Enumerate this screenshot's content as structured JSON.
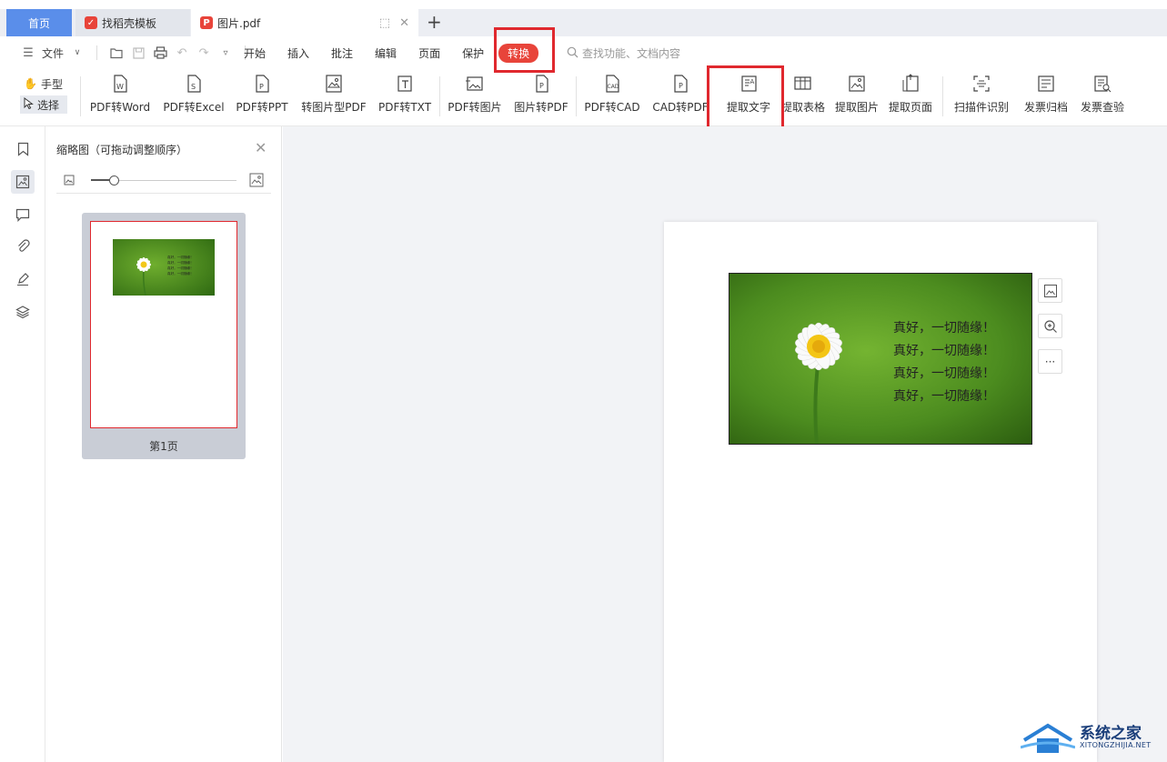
{
  "tabs": {
    "home": "首页",
    "template": "找稻壳模板",
    "pdf": "图片.pdf"
  },
  "menu": {
    "file": "文件",
    "items": [
      "开始",
      "插入",
      "批注",
      "编辑",
      "页面",
      "保护"
    ],
    "active": "转换",
    "search_placeholder": "查找功能、文档内容"
  },
  "ribbon": {
    "hand": "手型",
    "select": "选择",
    "buttons": [
      "PDF转Word",
      "PDF转Excel",
      "PDF转PPT",
      "转图片型PDF",
      "PDF转TXT",
      "PDF转图片",
      "图片转PDF",
      "PDF转CAD",
      "CAD转PDF",
      "提取文字",
      "提取表格",
      "提取图片",
      "提取页面",
      "扫描件识别",
      "发票归档",
      "发票查验"
    ]
  },
  "thumbnail_panel": {
    "title": "缩略图（可拖动调整顺序）",
    "page_label": "第1页"
  },
  "document": {
    "lines": [
      "真好，一切随缘！",
      "真好，一切随缘！",
      "真好，一切随缘！",
      "真好，一切随缘！"
    ]
  },
  "watermark": {
    "title": "系统之家",
    "subtitle": "XITONGZHIJIA.NET"
  },
  "colors": {
    "accent": "#e8443a",
    "highlight": "#e0282e",
    "home_tab": "#5a8eea"
  }
}
